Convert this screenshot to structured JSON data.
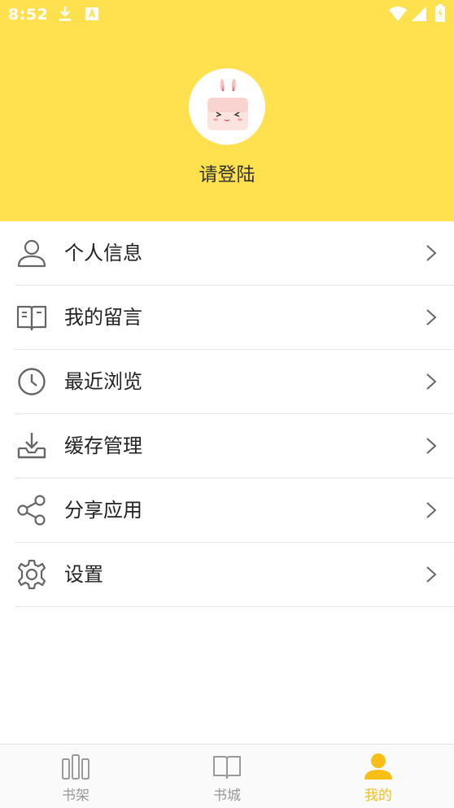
{
  "status_bar": {
    "time": "8:52",
    "left_icons": [
      "download-icon",
      "a-notification-icon"
    ],
    "right_icons": [
      "wifi-icon",
      "cellular-signal-icon",
      "battery-icon"
    ]
  },
  "profile": {
    "avatar_icon": "bunny-avatar-icon",
    "login_prompt": "请登陆"
  },
  "menu": {
    "items": [
      {
        "label": "个人信息",
        "icon": "person-icon"
      },
      {
        "label": "我的留言",
        "icon": "open-book-icon"
      },
      {
        "label": "最近浏览",
        "icon": "clock-icon"
      },
      {
        "label": "缓存管理",
        "icon": "download-tray-icon"
      },
      {
        "label": "分享应用",
        "icon": "share-icon"
      },
      {
        "label": "设置",
        "icon": "gear-icon"
      }
    ]
  },
  "bottom_nav": {
    "tabs": [
      {
        "label": "书架",
        "icon": "bookshelf-icon",
        "active": false
      },
      {
        "label": "书城",
        "icon": "book-icon",
        "active": false
      },
      {
        "label": "我的",
        "icon": "user-icon",
        "active": true
      }
    ]
  },
  "colors": {
    "header_background": "#FFE14F",
    "active_tab": "#F7BE16",
    "inactive_tab": "#999999",
    "icon_gray": "#666666"
  }
}
